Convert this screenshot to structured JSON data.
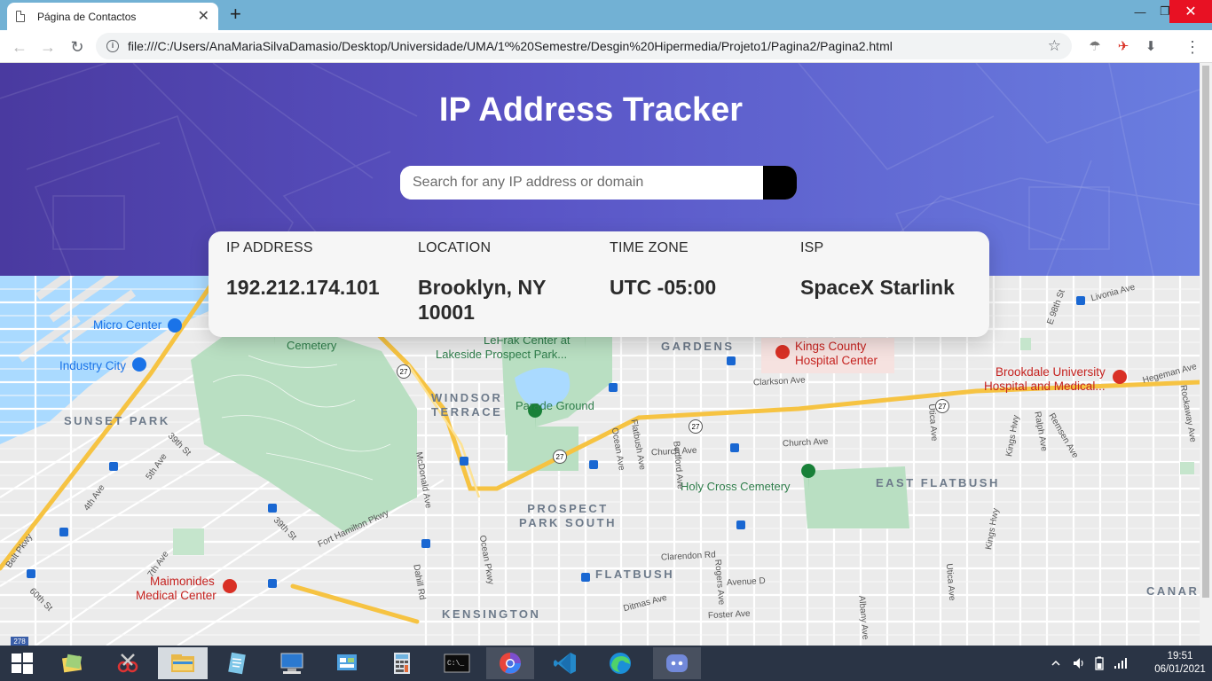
{
  "browser": {
    "tab_title": "Página de Contactos",
    "url": "file:///C:/Users/AnaMariaSilvaDamasio/Desktop/Universidade/UMA/1º%20Semestre/Desgin%20Hipermedia/Projeto1/Pagina2/Pagina2.html"
  },
  "app": {
    "title": "IP Address Tracker",
    "search": {
      "placeholder": "Search for any IP address or domain",
      "value": ""
    },
    "info": {
      "ip": {
        "label": "IP ADDRESS",
        "value": "192.212.174.101"
      },
      "location": {
        "label": "LOCATION",
        "value": "Brooklyn, NY 10001"
      },
      "timezone": {
        "label": "TIME ZONE",
        "value": "UTC -05:00"
      },
      "isp": {
        "label": "ISP",
        "value": "SpaceX Starlink"
      }
    }
  },
  "map": {
    "areas": [
      "SUNSET PARK",
      "WINDSOR TERRACE",
      "GARDENS",
      "PROSPECT PARK SOUTH",
      "FLATBUSH",
      "KENSINGTON",
      "EAST FLATBUSH",
      "CANAR"
    ],
    "pois": {
      "micro_center": "Micro Center",
      "industry_city": "Industry City",
      "cemetery": "Cemetery",
      "lefrak": "LeFrak Center at",
      "lakeside": "Lakeside Prospect Park...",
      "parade_ground": "Parade Ground",
      "holy_cross": "Holy Cross Cemetery",
      "kings_county_1": "Kings County",
      "kings_county_2": "Hospital Center",
      "brookdale_1": "Brookdale University",
      "brookdale_2": "Hospital and Medical...",
      "maimonides_1": "Maimonides",
      "maimonides_2": "Medical Center"
    },
    "streets": {
      "clarkson": "Clarkson Ave",
      "church_1": "Church Ave",
      "church_2": "Church Ave",
      "flatbush_ave": "Flatbush Ave",
      "ocean_ave": "Ocean Ave",
      "bedford": "Bedford Ave",
      "mcdonald": "McDonald Ave",
      "fort_hamilton": "Fort Hamilton Pkwy",
      "ocean_pkwy": "Ocean Pkwy",
      "dahill": "Dahill Rd",
      "clarendon": "Clarendon Rd",
      "avenue_d": "Avenue D",
      "ditmas": "Ditmas Ave",
      "foster": "Foster Ave",
      "rogers": "Rogers Ave",
      "utica_1": "Utica Ave",
      "utica_2": "Utica Ave",
      "kings_hwy_1": "Kings Hwy",
      "kings_hwy_2": "Kings Hwy",
      "ralph": "Ralph Ave",
      "remsen": "Remsen Ave",
      "hegeman": "Hegeman Ave",
      "rockaway": "Rockaway Ave",
      "livonia": "Livonia Ave",
      "e98": "E 98th St",
      "39th_1": "39th St",
      "39th_2": "39th St",
      "5th_ave": "5th Ave",
      "4th_ave": "4th Ave",
      "7th_ave": "7th Ave",
      "60th": "60th St",
      "belt_pkwy": "Belt Pkwy",
      "albany": "Albany Ave"
    },
    "route_shields": [
      "27",
      "27",
      "27",
      "27",
      "27",
      "278"
    ]
  },
  "taskbar": {
    "time": "19:51",
    "date": "06/01/2021"
  }
}
